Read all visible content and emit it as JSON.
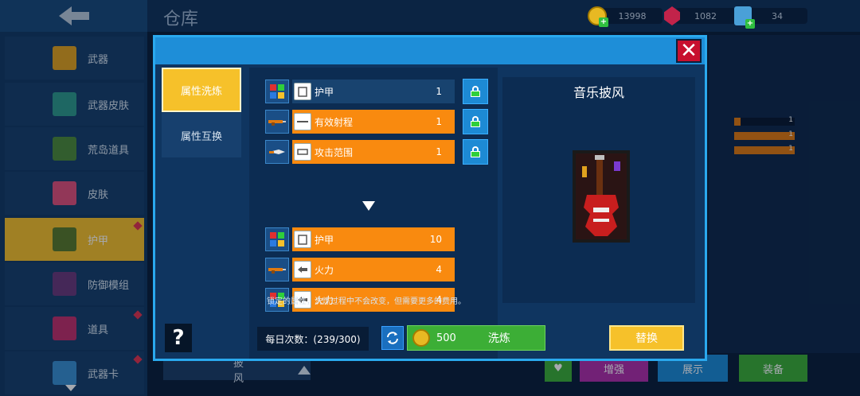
{
  "header": {
    "title": "仓库",
    "currencies": [
      {
        "icon": "coin-icon",
        "value": "13998"
      },
      {
        "icon": "gem-icon",
        "value": "1082"
      },
      {
        "icon": "ticket-icon",
        "value": "34"
      }
    ]
  },
  "sidebar": {
    "items": [
      {
        "label": "武器",
        "icon": "weapon-icon",
        "active": false,
        "badge": false
      },
      {
        "label": "武器皮肤",
        "icon": "weapon-skin-icon",
        "active": false,
        "badge": false
      },
      {
        "label": "荒岛道具",
        "icon": "island-item-icon",
        "active": false,
        "badge": false
      },
      {
        "label": "皮肤",
        "icon": "skin-icon",
        "active": false,
        "badge": false
      },
      {
        "label": "护甲",
        "icon": "armor-icon",
        "active": true,
        "badge": true
      },
      {
        "label": "防御模组",
        "icon": "defense-module-icon",
        "active": false,
        "badge": false
      },
      {
        "label": "道具",
        "icon": "gadget-icon",
        "active": false,
        "badge": true
      },
      {
        "label": "武器卡",
        "icon": "weapon-card-icon",
        "active": false,
        "badge": true
      }
    ]
  },
  "background": {
    "stats": [
      {
        "value": "1",
        "fraction": 0.1
      },
      {
        "value": "1",
        "fraction": 1.0
      },
      {
        "value": "1",
        "fraction": 1.0
      }
    ],
    "bottom_label": "披风",
    "buttons": [
      {
        "label": "",
        "icon": "heart-icon",
        "color": "#3cae36"
      },
      {
        "label": "增强",
        "color": "#b02ea8"
      },
      {
        "label": "展示",
        "color": "#1d8ad4"
      },
      {
        "label": "装备",
        "color": "#3cae36"
      }
    ]
  },
  "modal": {
    "tabs": [
      {
        "label": "属性洗炼",
        "active": true
      },
      {
        "label": "属性互换",
        "active": false
      }
    ],
    "help_label": "?",
    "current_attrs": [
      {
        "label": "护甲",
        "value": "1",
        "style": "dark",
        "icon": "armor-vest-icon",
        "slot_icon": "multicolor-grid-icon",
        "locked": true
      },
      {
        "label": "有效射程",
        "value": "1",
        "style": "orange",
        "icon": "range-icon",
        "slot_icon": "rifle-icon",
        "locked": true
      },
      {
        "label": "攻击范围",
        "value": "1",
        "style": "orange",
        "icon": "melee-range-icon",
        "slot_icon": "knife-icon",
        "locked": true
      }
    ],
    "new_attrs": [
      {
        "label": "护甲",
        "value": "10",
        "style": "orange",
        "icon": "armor-vest-icon",
        "slot_icon": "multicolor-grid-icon"
      },
      {
        "label": "火力",
        "value": "4",
        "style": "orange",
        "icon": "firepower-icon",
        "slot_icon": "rifle-icon"
      },
      {
        "label": "火力",
        "value": "4",
        "style": "orange",
        "icon": "firepower-icon",
        "slot_icon": "multicolor-grid-icon"
      }
    ],
    "note": "锁定的属性，洗炼过程中不会改变，但需要更多的费用。",
    "daily_count": "每日次数：(239/300)",
    "refine": {
      "cost": "500",
      "label": "洗炼"
    },
    "preview_title": "音乐披风",
    "replace_label": "替换"
  },
  "colors": {
    "accent_yellow": "#f6c12a",
    "attr_orange": "#f98a0f",
    "refine_green": "#3cae36",
    "close_red": "#c8102e",
    "modal_border": "#2aa9ee"
  }
}
